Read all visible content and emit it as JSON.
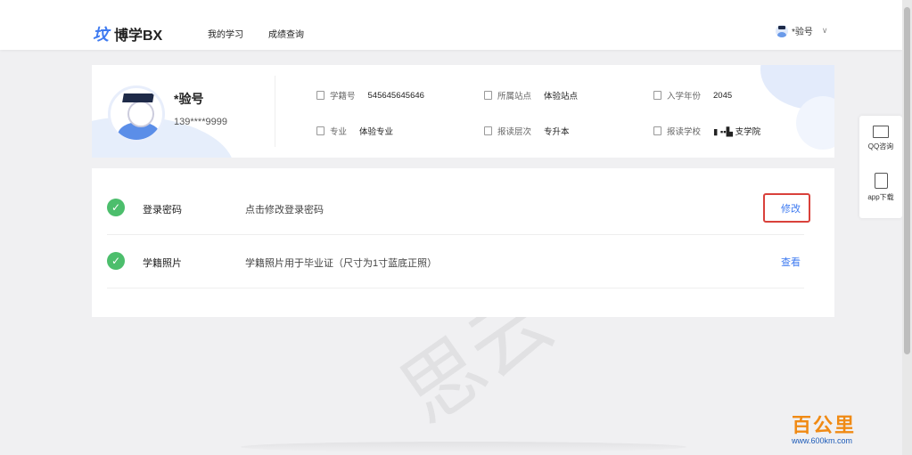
{
  "header": {
    "logo_mark": "坟",
    "logo_text": "博学BX",
    "nav": [
      "我的学习",
      "成绩查询"
    ],
    "user_name": "*验号",
    "user_chevron": "∨"
  },
  "profile": {
    "name": "*验号",
    "phone": "139****9999",
    "info": {
      "student_id_label": "学籍号",
      "student_id": "545645645646",
      "station_label": "所属站点",
      "station": "体验站点",
      "year_label": "入学年份",
      "year": "2045",
      "major_label": "专业",
      "major": "体验专业",
      "level_label": "报读层次",
      "level": "专升本",
      "school_label": "报读学校",
      "school": "▮ ▪▪▙ 支学院"
    }
  },
  "security": {
    "rows": [
      {
        "title": "登录密码",
        "desc": "点击修改登录密码",
        "action": "修改"
      },
      {
        "title": "学籍照片",
        "desc": "学籍照片用于毕业证（尺寸为1寸蓝底正照）",
        "action": "查看"
      }
    ]
  },
  "sidebar": {
    "qq": "QQ咨询",
    "app": "app下载"
  },
  "watermark": {
    "ghost_text": "思云",
    "logo": "百公里",
    "url": "www.600km.com"
  }
}
